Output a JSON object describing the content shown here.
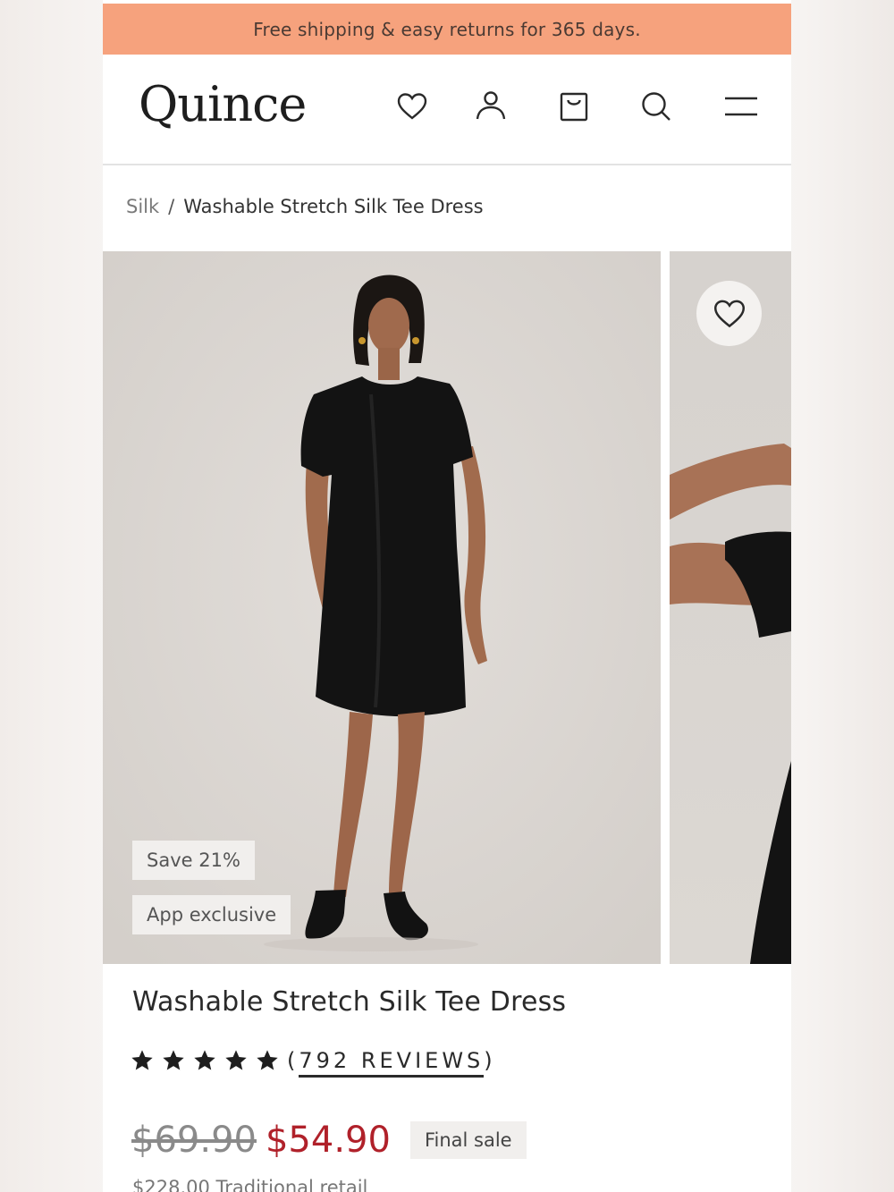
{
  "promo": {
    "text": "Free shipping & easy returns for 365 days."
  },
  "header": {
    "logo": "Quince",
    "icons": [
      "heart-icon",
      "user-icon",
      "bag-icon",
      "search-icon",
      "menu-icon"
    ]
  },
  "breadcrumb": {
    "parent": "Silk",
    "separator": "/",
    "current": "Washable Stretch Silk Tee Dress"
  },
  "gallery": {
    "badges": {
      "save": "Save 21%",
      "app": "App exclusive"
    }
  },
  "product": {
    "title": "Washable Stretch Silk Tee Dress",
    "rating_stars": 5,
    "reviews_open": "(",
    "reviews_label": "792 REVIEWS",
    "reviews_close": ")",
    "old_price": "$69.90",
    "new_price": "$54.90",
    "final_sale": "Final sale",
    "retail": "$228.00 Traditional retail"
  },
  "colors": {
    "promo_bg": "#f6a27d",
    "sale_price": "#b0212a"
  }
}
